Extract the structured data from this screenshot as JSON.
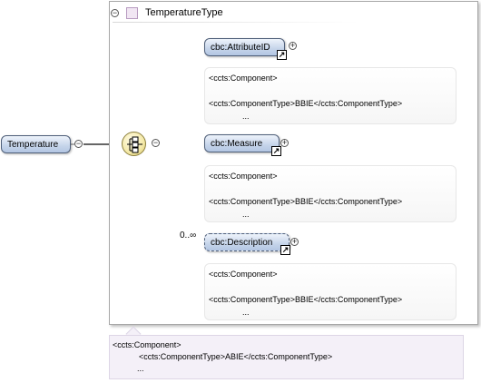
{
  "root": {
    "name": "Temperature"
  },
  "complex_type": {
    "name": "TemperatureType"
  },
  "children": [
    {
      "name": "cbc:AttributeID",
      "cardinality": "",
      "annotation": [
        "<ccts:Component>",
        "<ccts:ComponentType>BBIE</ccts:ComponentType>",
        "..."
      ]
    },
    {
      "name": "cbc:Measure",
      "cardinality": "",
      "annotation": [
        "<ccts:Component>",
        "<ccts:ComponentType>BBIE</ccts:ComponentType>",
        "..."
      ]
    },
    {
      "name": "cbc:Description",
      "cardinality": "0..∞",
      "annotation": [
        "<ccts:Component>",
        "<ccts:ComponentType>BBIE</ccts:ComponentType>",
        "..."
      ]
    }
  ],
  "type_annotation": [
    "<ccts:Component>",
    "<ccts:ComponentType>ABIE</ccts:ComponentType>",
    "..."
  ],
  "icons": {
    "collapse": "minus-circle-icon",
    "expand": "plus-circle-icon",
    "reference": "reference-arrow-icon",
    "sequence": "sequence-compositor-icon"
  },
  "colors": {
    "element_fill": "#c5d4ea",
    "element_border": "#4f5f79",
    "type_fill": "#f1e6f3",
    "compositor_fill": "#f4e9a8",
    "annotation_fill": "#f4f0f8"
  }
}
